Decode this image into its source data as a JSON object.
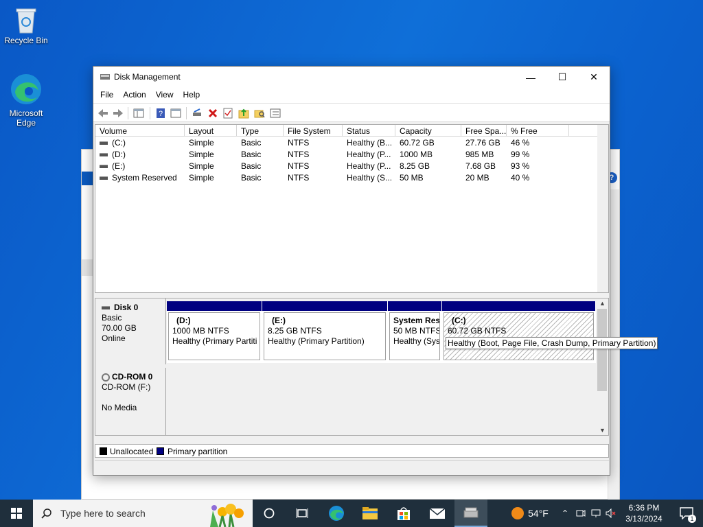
{
  "desktop": {
    "icons": [
      {
        "label": "Recycle Bin",
        "icon": "recycle-bin-icon"
      },
      {
        "label": "Microsoft Edge",
        "icon": "edge-icon"
      }
    ]
  },
  "window": {
    "title": "Disk Management",
    "menu": [
      "File",
      "Action",
      "View",
      "Help"
    ],
    "controls": {
      "minimize": "—",
      "maximize": "☐",
      "close": "✕"
    }
  },
  "volume_list": {
    "columns": [
      "Volume",
      "Layout",
      "Type",
      "File System",
      "Status",
      "Capacity",
      "Free Spa...",
      "% Free"
    ],
    "rows": [
      [
        "(C:)",
        "Simple",
        "Basic",
        "NTFS",
        "Healthy (B...",
        "60.72 GB",
        "27.76 GB",
        "46 %"
      ],
      [
        "(D:)",
        "Simple",
        "Basic",
        "NTFS",
        "Healthy (P...",
        "1000 MB",
        "985 MB",
        "99 %"
      ],
      [
        "(E:)",
        "Simple",
        "Basic",
        "NTFS",
        "Healthy (P...",
        "8.25 GB",
        "7.68 GB",
        "93 %"
      ],
      [
        "System Reserved",
        "Simple",
        "Basic",
        "NTFS",
        "Healthy (S...",
        "50 MB",
        "20 MB",
        "40 %"
      ]
    ]
  },
  "disks": [
    {
      "name": "Disk 0",
      "type": "Basic",
      "size": "70.00 GB",
      "state": "Online",
      "partitions": [
        {
          "name": "(D:)",
          "size": "1000 MB NTFS",
          "status": "Healthy (Primary Partiti"
        },
        {
          "name": "(E:)",
          "size": "8.25 GB NTFS",
          "status": "Healthy (Primary Partition)"
        },
        {
          "name": "System Res",
          "size": "50 MB NTFS",
          "status": "Healthy (Sys"
        },
        {
          "name": "(C:)",
          "size": "60.72 GB NTFS",
          "status": ""
        }
      ]
    },
    {
      "name": "CD-ROM 0",
      "type": "CD-ROM (F:)",
      "size": "",
      "state": "No Media"
    }
  ],
  "legend": {
    "unallocated": "Unallocated",
    "primary": "Primary partition"
  },
  "tooltip": "Healthy (Boot, Page File, Crash Dump, Primary Partition)",
  "taskbar": {
    "search_placeholder": "Type here to search",
    "weather": "54°F",
    "time": "6:36 PM",
    "date": "3/13/2024",
    "notification_count": "1"
  },
  "colors": {
    "primary_partition": "#000080",
    "accent": "#0a5ac0"
  }
}
